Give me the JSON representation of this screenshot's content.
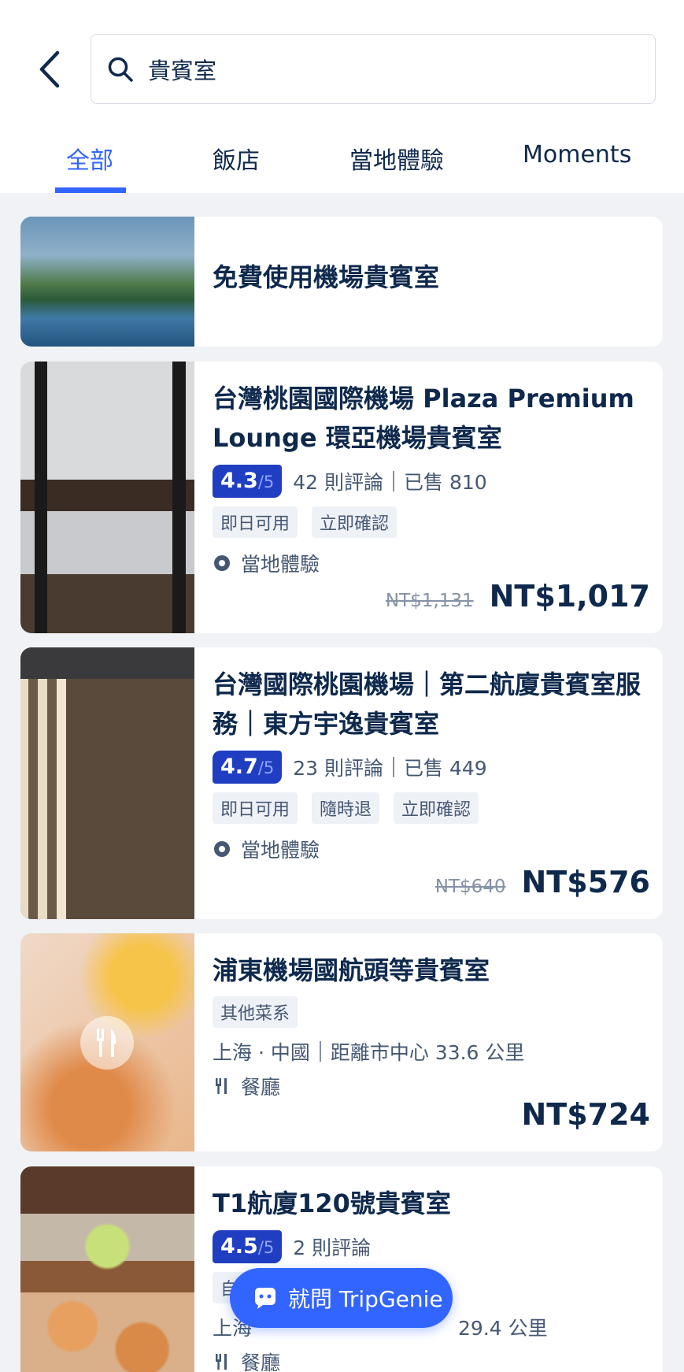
{
  "search": {
    "value": "貴賓室"
  },
  "tabs": [
    {
      "label": "全部"
    },
    {
      "label": "飯店"
    },
    {
      "label": "當地體驗"
    },
    {
      "label": "Moments"
    }
  ],
  "results": [
    {
      "title": "免費使用機場貴賓室"
    },
    {
      "title": "台灣桃園國際機場 Plaza Premium Lounge 環亞機場貴賓室",
      "rating": "4.3",
      "rating_out": "/5",
      "reviews": "42 則評論",
      "sold": "已售 810",
      "tags": [
        "即日可用",
        "立即確認"
      ],
      "category": "當地體驗",
      "old_price": "NT$1,131",
      "price": "NT$1,017"
    },
    {
      "title": "台灣國際桃園機場｜第二航廈貴賓室服務｜東方宇逸貴賓室",
      "rating": "4.7",
      "rating_out": "/5",
      "reviews": "23 則評論",
      "sold": "已售 449",
      "tags": [
        "即日可用",
        "隨時退",
        "立即確認"
      ],
      "category": "當地體驗",
      "old_price": "NT$640",
      "price": "NT$576"
    },
    {
      "title": "浦東機場國航頭等貴賓室",
      "tags": [
        "其他菜系"
      ],
      "location": "上海 · 中國",
      "distance": "距離市中心 33.6 公里",
      "category": "餐廳",
      "price": "NT$724"
    },
    {
      "title": "T1航廈120號貴賓室",
      "rating": "4.5",
      "rating_out": "/5",
      "reviews": "2 則評論",
      "tag_partial": "自",
      "location": "上海",
      "distance_partial": "29.4 公里",
      "category": "餐廳"
    }
  ],
  "genie": {
    "label": "就問 TripGenie"
  },
  "colors": {
    "accent": "#3264ff",
    "navy": "#0f294d",
    "badge": "#1f3ec1"
  }
}
